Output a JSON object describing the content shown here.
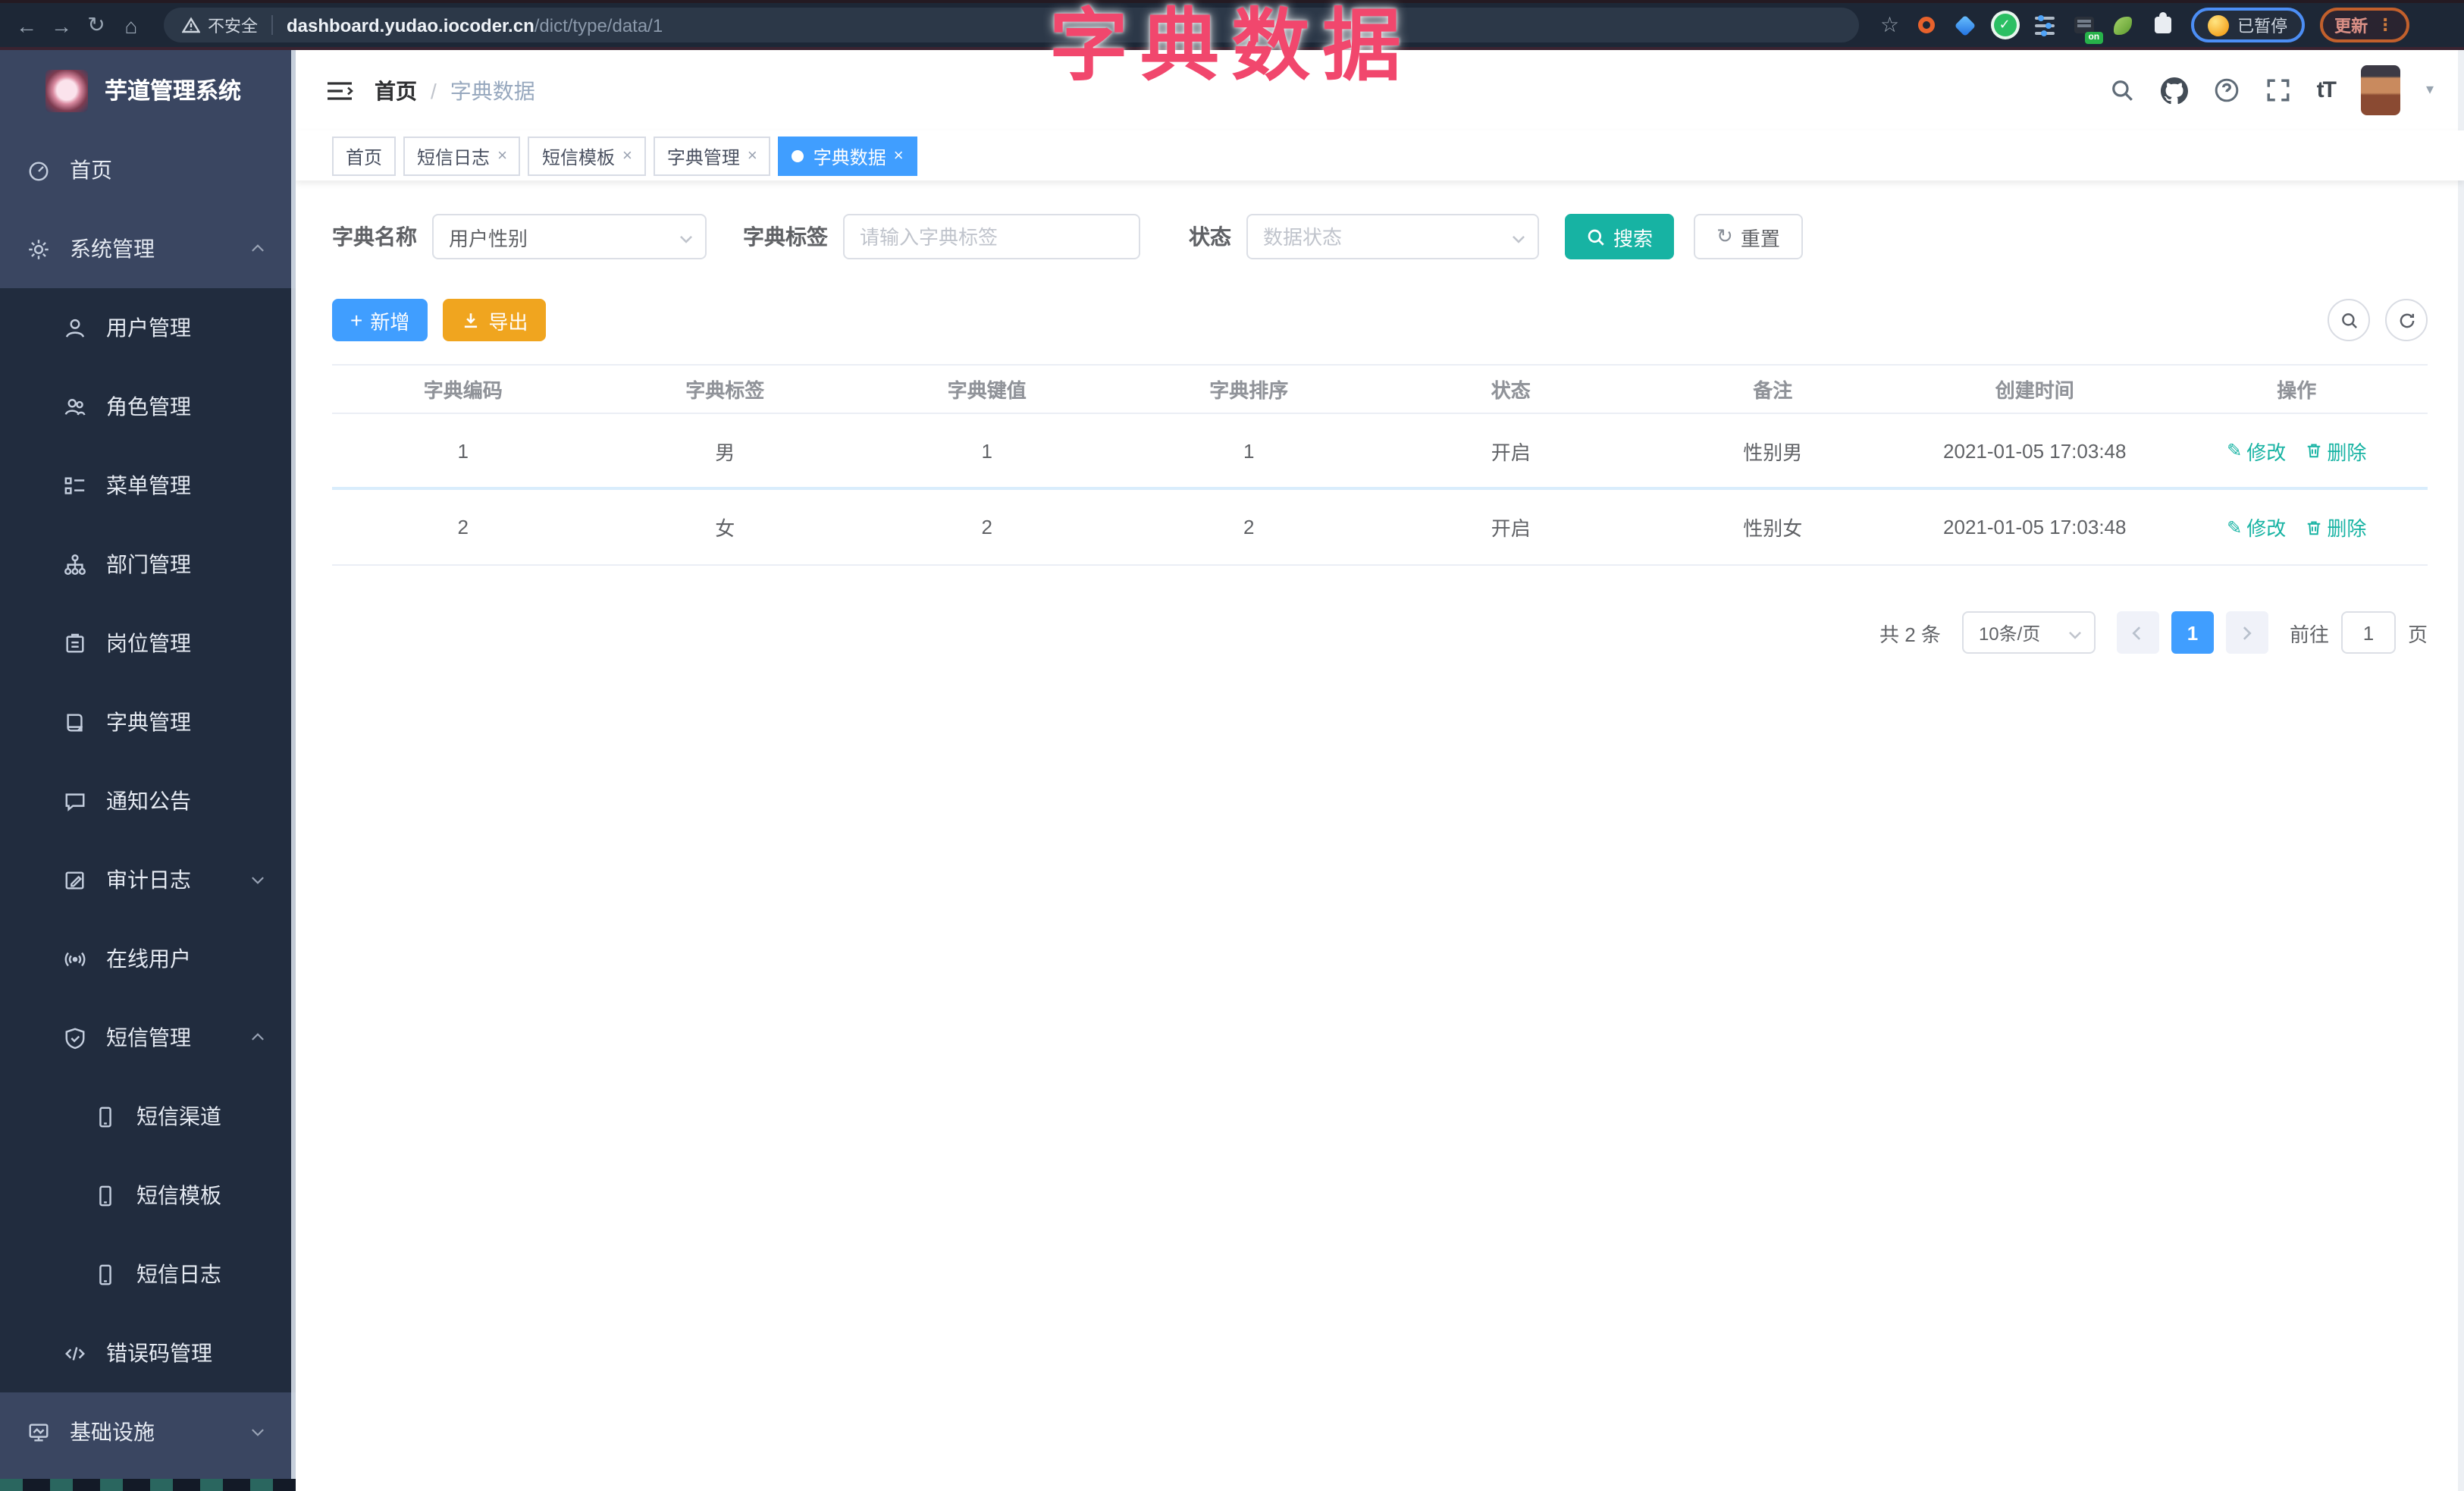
{
  "browser": {
    "security_label": "不安全",
    "url_host": "dashboard.yudao.iocoder.cn",
    "url_path": "/dict/type/data/1",
    "paused_label": "已暂停",
    "update_label": "更新",
    "on_badge_label": "on",
    "menu_dots": "⋮",
    "back_glyph": "←",
    "forward_glyph": "→",
    "reload_glyph": "↻",
    "home_glyph": "⌂",
    "star_glyph": "☆"
  },
  "overlay_title": "字典数据",
  "sidebar": {
    "brand": "芋道管理系统",
    "items": [
      {
        "label": "首页"
      },
      {
        "label": "系统管理"
      },
      {
        "label": "用户管理"
      },
      {
        "label": "角色管理"
      },
      {
        "label": "菜单管理"
      },
      {
        "label": "部门管理"
      },
      {
        "label": "岗位管理"
      },
      {
        "label": "字典管理"
      },
      {
        "label": "通知公告"
      },
      {
        "label": "审计日志"
      },
      {
        "label": "在线用户"
      },
      {
        "label": "短信管理"
      },
      {
        "label": "短信渠道"
      },
      {
        "label": "短信模板"
      },
      {
        "label": "短信日志"
      },
      {
        "label": "错误码管理"
      },
      {
        "label": "基础设施"
      }
    ]
  },
  "header": {
    "breadcrumb_home": "首页",
    "breadcrumb_sep": "/",
    "breadcrumb_current": "字典数据",
    "font_size_icon_label": "tT",
    "help_glyph": "?",
    "caret_glyph": "▾"
  },
  "tabs": [
    {
      "label": "首页"
    },
    {
      "label": "短信日志"
    },
    {
      "label": "短信模板"
    },
    {
      "label": "字典管理"
    },
    {
      "label": "字典数据"
    }
  ],
  "tab_close_glyph": "×",
  "search_form": {
    "dict_type_label": "字典名称",
    "dict_type_value": "用户性别",
    "dict_label_label": "字典标签",
    "dict_label_placeholder": "请输入字典标签",
    "status_label": "状态",
    "status_placeholder": "数据状态",
    "search_button": "搜索",
    "reset_button": "重置",
    "reset_glyph": "↻"
  },
  "toolbar": {
    "add_button": "新增",
    "add_glyph": "+",
    "export_button": "导出"
  },
  "table": {
    "columns": [
      "字典编码",
      "字典标签",
      "字典键值",
      "字典排序",
      "状态",
      "备注",
      "创建时间",
      "操作"
    ],
    "rows": [
      {
        "cells": [
          "1",
          "男",
          "1",
          "1",
          "开启",
          "性别男",
          "2021-01-05 17:03:48"
        ]
      },
      {
        "cells": [
          "2",
          "女",
          "2",
          "2",
          "开启",
          "性别女",
          "2021-01-05 17:03:48"
        ]
      }
    ],
    "actions": {
      "edit": "修改",
      "delete": "删除",
      "edit_glyph": "✎"
    }
  },
  "pagination": {
    "total": "共 2 条",
    "page_size": "10条/页",
    "current_page": "1",
    "goto_label": "前往",
    "goto_value": "1",
    "goto_unit": "页"
  },
  "colors": {
    "primary_blue": "#409eff",
    "action_teal": "#17b3a3",
    "export_orange": "#f0a51f",
    "overlay_red": "#f1476d",
    "sidebar_bg": "#3a4661",
    "submenu_bg": "#212c3e",
    "chrome_bg": "#1d2736"
  }
}
